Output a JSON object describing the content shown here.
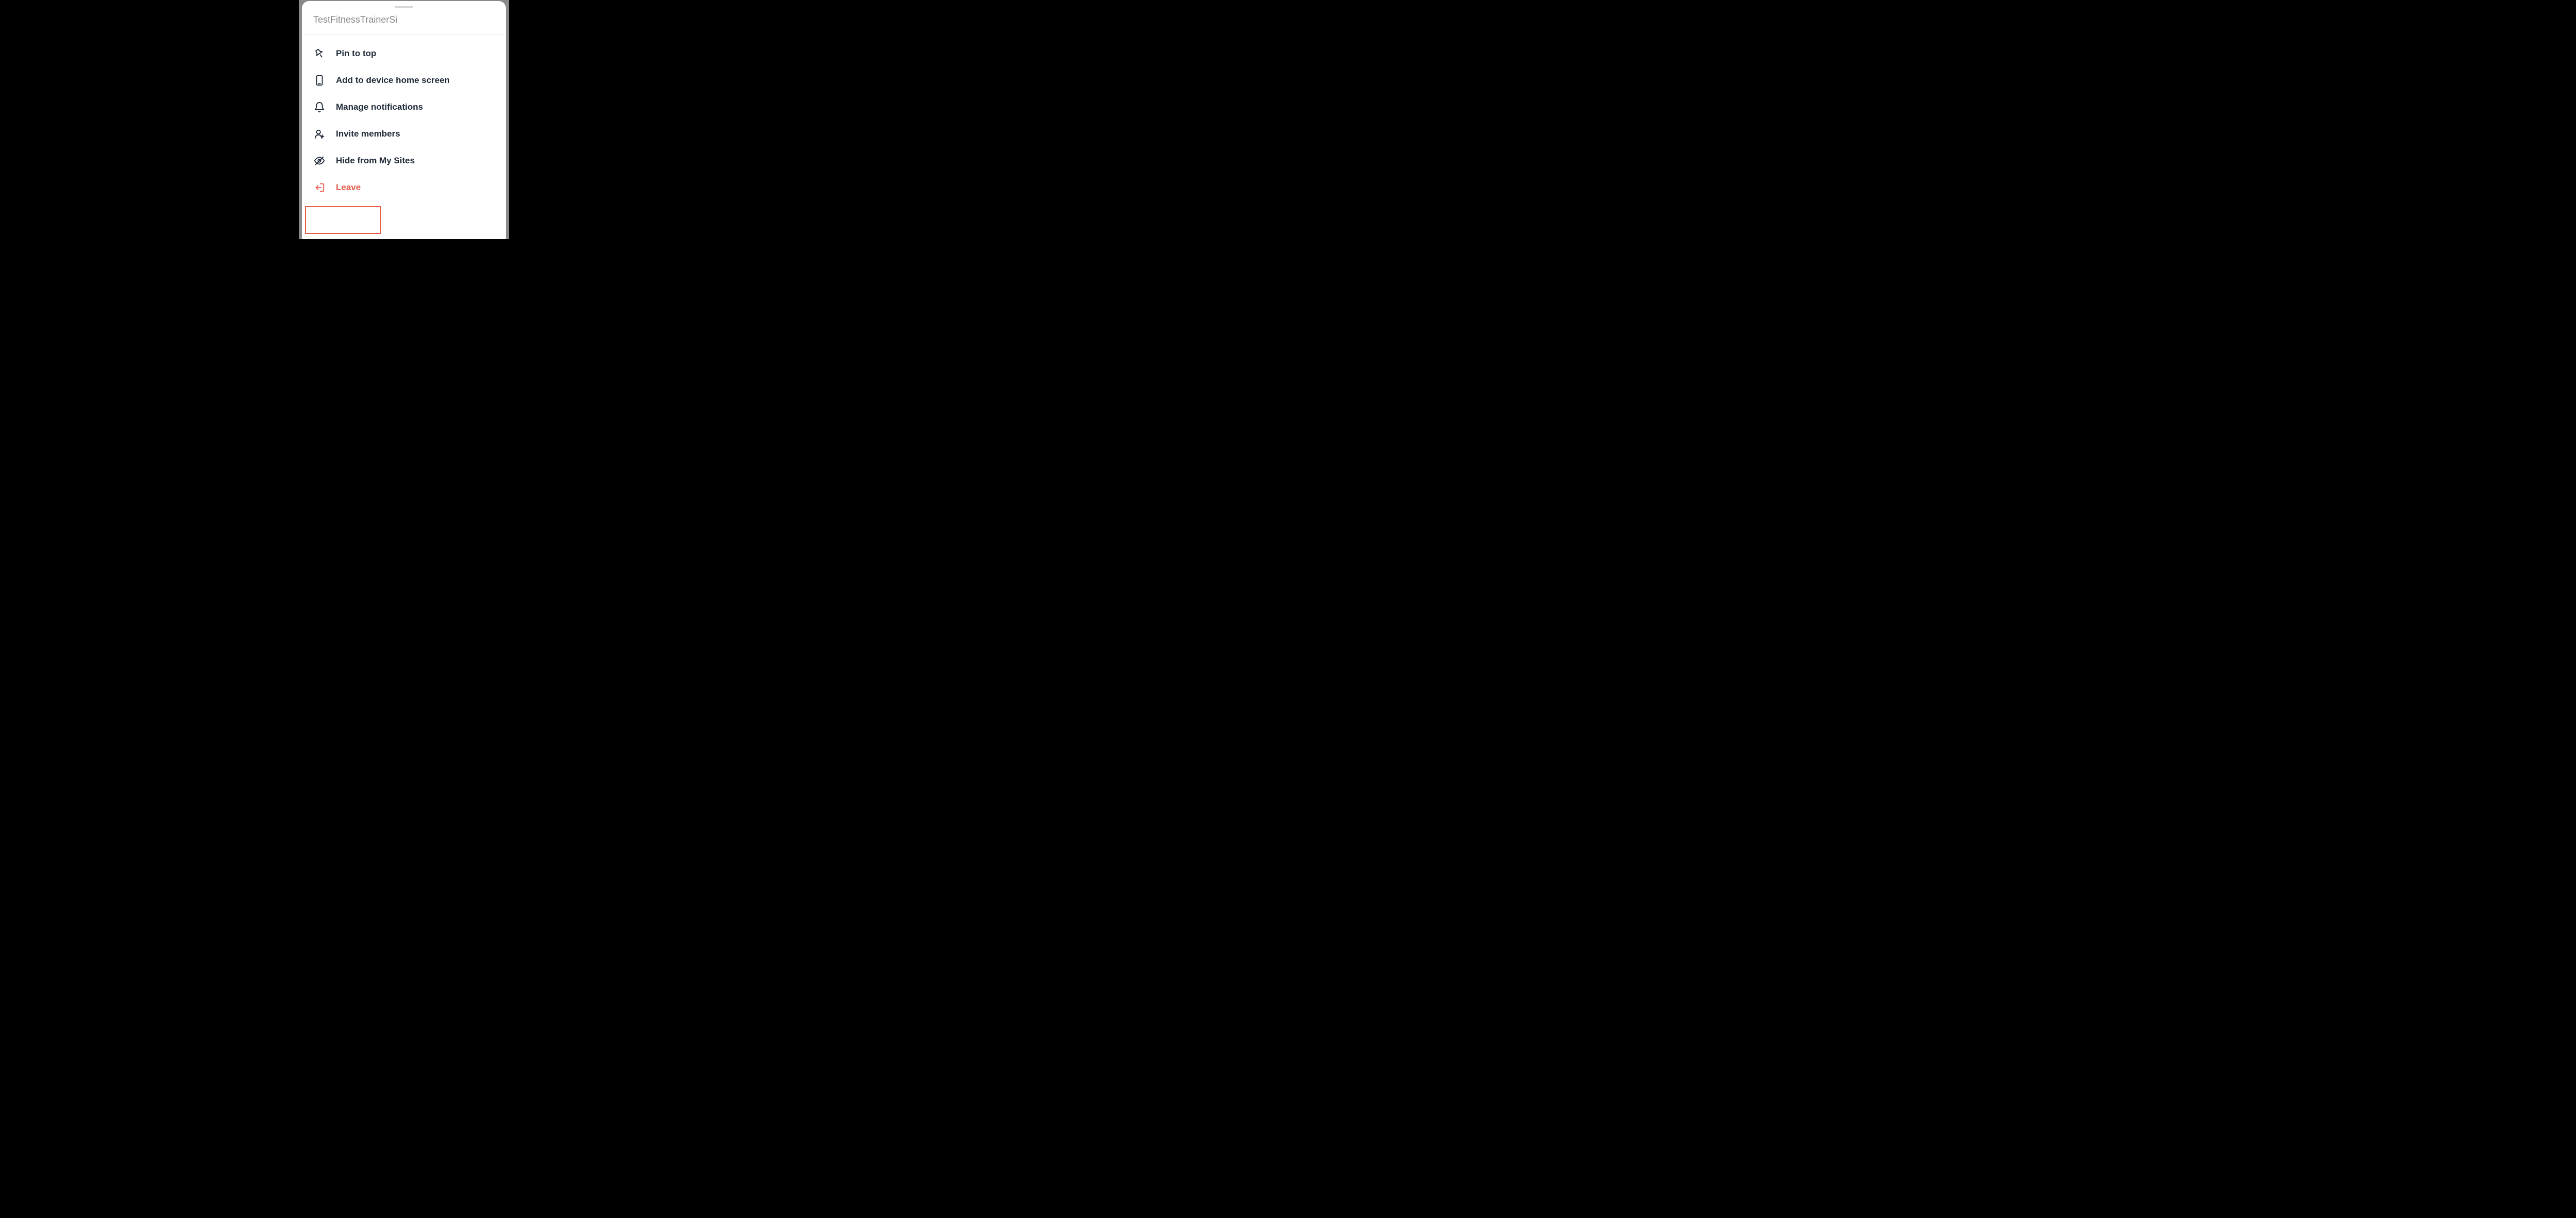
{
  "modal": {
    "title": "TestFitnessTrainerSi",
    "items": [
      {
        "label": "Pin to top",
        "icon": "pin-icon",
        "danger": false
      },
      {
        "label": "Add to device home screen",
        "icon": "phone-icon",
        "danger": false
      },
      {
        "label": "Manage notifications",
        "icon": "bell-icon",
        "danger": false
      },
      {
        "label": "Invite members",
        "icon": "person-plus-icon",
        "danger": false
      },
      {
        "label": "Hide from My Sites",
        "icon": "eye-off-icon",
        "danger": false
      },
      {
        "label": "Leave",
        "icon": "exit-icon",
        "danger": true
      }
    ]
  },
  "colors": {
    "danger": "#e85c4a",
    "text": "#1f2937",
    "muted": "#888888"
  }
}
